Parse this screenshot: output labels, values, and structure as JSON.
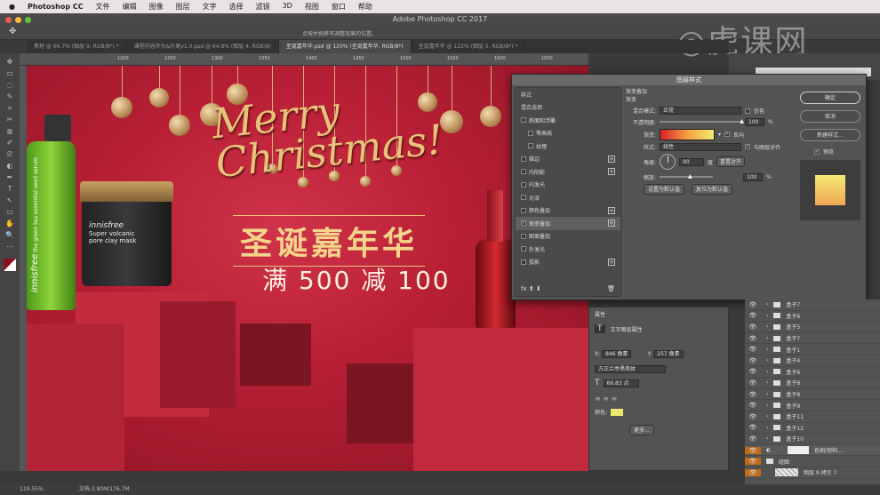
{
  "menubar": {
    "app": "Photoshop CC",
    "items": [
      "文件",
      "编辑",
      "图像",
      "图层",
      "文字",
      "选择",
      "滤镜",
      "3D",
      "视图",
      "窗口",
      "帮助"
    ]
  },
  "window_title": "Adobe Photoshop CC 2017",
  "options_hint": "点按并拖移可调整效果的位置。",
  "tabs": [
    "素材 @ 66.7% (图层 9, RGB/8*) *",
    "课程内容开头&片尾v1.0.psd @ 64.8% (图层 4, RGB/8)",
    "圣诞嘉年华.psd @ 120% (圣诞嘉年华, RGB/8*)",
    "圣诞嘉年华 @ 122% (图层 5, RGB/8*) *"
  ],
  "ruler_ticks": [
    "1200",
    "1250",
    "1300",
    "1350",
    "1400",
    "1450",
    "1500",
    "1550",
    "1600",
    "1650"
  ],
  "canvas": {
    "merry": "Merry",
    "christmas": "Christmas!",
    "title": "圣诞嘉年华",
    "promo": "满 500 减 100",
    "jar_brand": "innisfree",
    "jar_line1": "Super volcanic",
    "jar_line2": "pore clay mask",
    "bottle_brand": "innisfree",
    "bottle_text": "the green tea essential seed serum"
  },
  "dialog": {
    "title": "图层样式",
    "styles_header": "样式",
    "styles": [
      {
        "label": "混合选项",
        "cb": false,
        "plus": false,
        "hasCb": false
      },
      {
        "label": "斜面和浮雕",
        "cb": false,
        "plus": false,
        "hasCb": true
      },
      {
        "label": "等高线",
        "cb": false,
        "plus": false,
        "hasCb": true,
        "indent": true
      },
      {
        "label": "纹理",
        "cb": false,
        "plus": false,
        "hasCb": true,
        "indent": true
      },
      {
        "label": "描边",
        "cb": false,
        "plus": true,
        "hasCb": true
      },
      {
        "label": "内阴影",
        "cb": false,
        "plus": true,
        "hasCb": true
      },
      {
        "label": "内发光",
        "cb": false,
        "plus": false,
        "hasCb": true
      },
      {
        "label": "光泽",
        "cb": false,
        "plus": false,
        "hasCb": true
      },
      {
        "label": "颜色叠加",
        "cb": false,
        "plus": true,
        "hasCb": true
      },
      {
        "label": "渐变叠加",
        "cb": true,
        "plus": true,
        "hasCb": true,
        "selected": true
      },
      {
        "label": "图案叠加",
        "cb": false,
        "plus": false,
        "hasCb": true
      },
      {
        "label": "外发光",
        "cb": false,
        "plus": false,
        "hasCb": true
      },
      {
        "label": "投影",
        "cb": false,
        "plus": true,
        "hasCb": true
      }
    ],
    "section": "渐变叠加",
    "subsection": "渐变",
    "blend_label": "混合模式:",
    "blend_value": "正常",
    "dither": "仿色",
    "opacity_label": "不透明度:",
    "opacity": "100",
    "pct": "%",
    "gradient_label": "渐变:",
    "reverse": "反向",
    "style_label": "样式:",
    "style_value": "线性",
    "align": "与图层对齐",
    "angle_label": "角度:",
    "angle": "90",
    "deg": "度",
    "reset_align": "重置对齐",
    "scale_label": "缩放:",
    "scale": "100",
    "set_default": "设置为默认值",
    "reset_default": "复位为默认值",
    "ok": "确定",
    "cancel": "取消",
    "new_style": "新建样式...",
    "preview": "预览",
    "gradient_colors": [
      "#d8202a",
      "#f5a040",
      "#f2ec70"
    ]
  },
  "properties": {
    "title": "属性",
    "type_label": "文字图层属性",
    "x_label": "X:",
    "x": "846 像素",
    "y_label": "Y:",
    "y": "257 像素",
    "font": "方正兰亭黑简体",
    "size": "66.83 点",
    "color_label": "颜色:",
    "color": "#e8e86a",
    "more": "更多..."
  },
  "layers": [
    {
      "name": "盒子7"
    },
    {
      "name": "盒子6"
    },
    {
      "name": "盒子5"
    },
    {
      "name": "盒子7"
    },
    {
      "name": "盒子1"
    },
    {
      "name": "盒子4"
    },
    {
      "name": "盒子6"
    },
    {
      "name": "盒子8"
    },
    {
      "name": "盒子8"
    },
    {
      "name": "盒子9"
    },
    {
      "name": "盒子11"
    },
    {
      "name": "盒子12"
    },
    {
      "name": "盒子10"
    }
  ],
  "layers_extra": {
    "adjust": "色相/饱和...",
    "group": "组图",
    "copy": "图层 9 拷贝 7"
  },
  "status": {
    "zoom": "119.55%",
    "doc": "文档:3.80M/176.7M"
  },
  "watermark": "虎课网"
}
